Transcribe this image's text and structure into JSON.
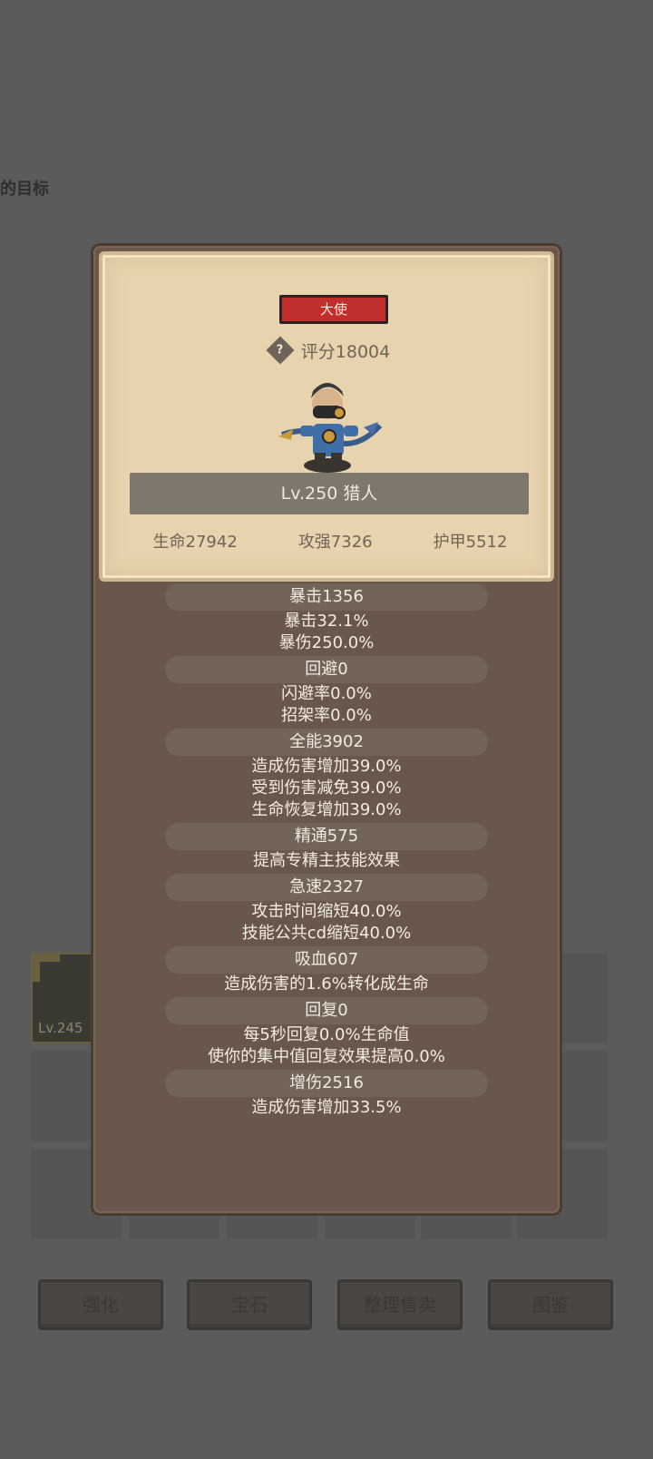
{
  "background": {
    "target_text": "的目标",
    "slot_level": "Lv.245",
    "buttons": [
      "强化",
      "宝石",
      "整理售卖",
      "图鉴"
    ]
  },
  "card": {
    "rank": "大使",
    "help_icon_glyph": "?",
    "score": "评分18004",
    "level_class": "Lv.250 猎人",
    "stats": [
      "生命27942",
      "攻强7326",
      "护甲5512"
    ]
  },
  "sections": [
    {
      "head": "暴击1356",
      "lines": [
        "暴击32.1%",
        "暴伤250.0%"
      ]
    },
    {
      "head": "回避0",
      "lines": [
        "闪避率0.0%",
        "招架率0.0%"
      ]
    },
    {
      "head": "全能3902",
      "lines": [
        "造成伤害增加39.0%",
        "受到伤害减免39.0%",
        "生命恢复增加39.0%"
      ]
    },
    {
      "head": "精通575",
      "lines": [
        "提高专精主技能效果"
      ]
    },
    {
      "head": "急速2327",
      "lines": [
        "攻击时间缩短40.0%",
        "技能公共cd缩短40.0%"
      ]
    },
    {
      "head": "吸血607",
      "lines": [
        "造成伤害的1.6%转化成生命"
      ]
    },
    {
      "head": "回复0",
      "lines": [
        "每5秒回复0.0%生命值",
        "使你的集中值回复效果提高0.0%"
      ]
    },
    {
      "head": "增伤2516",
      "lines": [
        "造成伤害增加33.5%"
      ]
    }
  ],
  "colors": {
    "badge": "#c12e2e",
    "card_bg": "#e7d3ad",
    "modal_bg": "#68574a"
  }
}
